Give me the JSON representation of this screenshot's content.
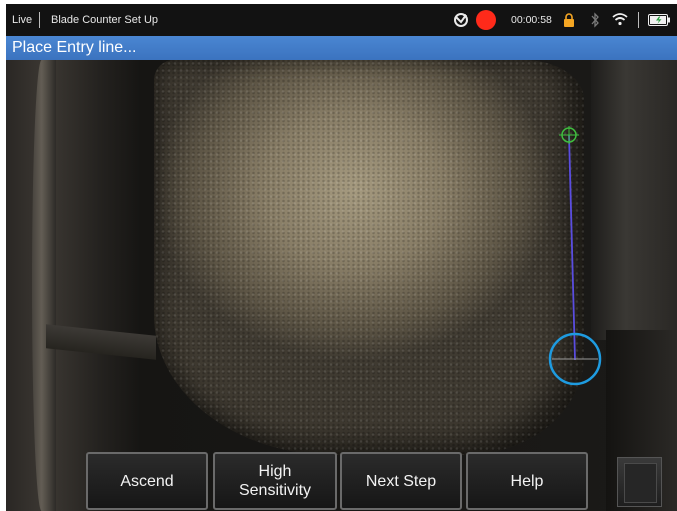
{
  "status_bar": {
    "mode": "Live",
    "title": "Blade Counter Set Up",
    "timer": "00:00:58",
    "icons": [
      "sync-icon",
      "record-icon",
      "lock-icon",
      "bluetooth-icon",
      "wifi-icon",
      "battery-icon"
    ],
    "record_color": "#ff2a1a",
    "lock_color": "#f5a623"
  },
  "prompt": {
    "text": "Place Entry line..."
  },
  "toolbar": {
    "ascend": "Ascend",
    "sensitivity_line1": "High",
    "sensitivity_line2": "Sensitivity",
    "next_step": "Next Step",
    "help": "Help"
  },
  "colors": {
    "prompt_bar": "#3b73bf",
    "entry_line": "#5a4de0",
    "cursor_ring": "#1e9be0",
    "top_marker": "#3fbf3f"
  }
}
